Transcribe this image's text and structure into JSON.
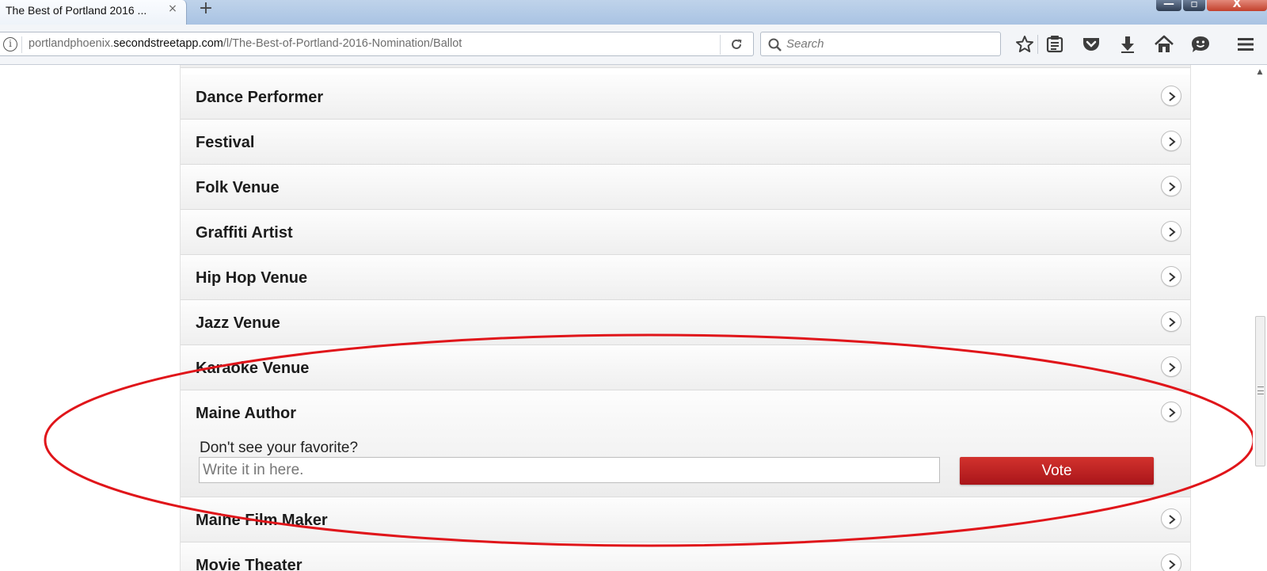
{
  "browser": {
    "tab_title": "The Best of Portland 2016 ...",
    "tab_close": "×",
    "new_tab": "+",
    "url_prefix": "portlandphoenix.",
    "url_domain": "secondstreetapp.com",
    "url_path": "/l/The-Best-of-Portland-2016-Nomination/Ballot",
    "search_placeholder": "Search",
    "window_controls": {
      "minimize": "—",
      "maximize": "▫",
      "close": "X"
    }
  },
  "toolbar_icons": [
    "star-icon",
    "reading-list-icon",
    "pocket-icon",
    "download-icon",
    "home-icon",
    "hello-icon",
    "menu-icon"
  ],
  "ballot": {
    "categories": [
      {
        "label": "Dance Performer",
        "expanded": false
      },
      {
        "label": "Festival",
        "expanded": false
      },
      {
        "label": "Folk Venue",
        "expanded": false
      },
      {
        "label": "Graffiti Artist",
        "expanded": false
      },
      {
        "label": "Hip Hop Venue",
        "expanded": false
      },
      {
        "label": "Jazz Venue",
        "expanded": false
      },
      {
        "label": "Karaoke Venue",
        "expanded": false
      },
      {
        "label": "Maine Author",
        "expanded": true
      },
      {
        "label": "Maine Film Maker",
        "expanded": false
      },
      {
        "label": "Movie Theater",
        "expanded": false
      }
    ],
    "write_in": {
      "prompt": "Don't see your favorite?",
      "placeholder": "Write it in here.",
      "vote_label": "Vote"
    }
  },
  "colors": {
    "vote_button": "#c0201f",
    "annotation_oval": "#e0151a"
  }
}
